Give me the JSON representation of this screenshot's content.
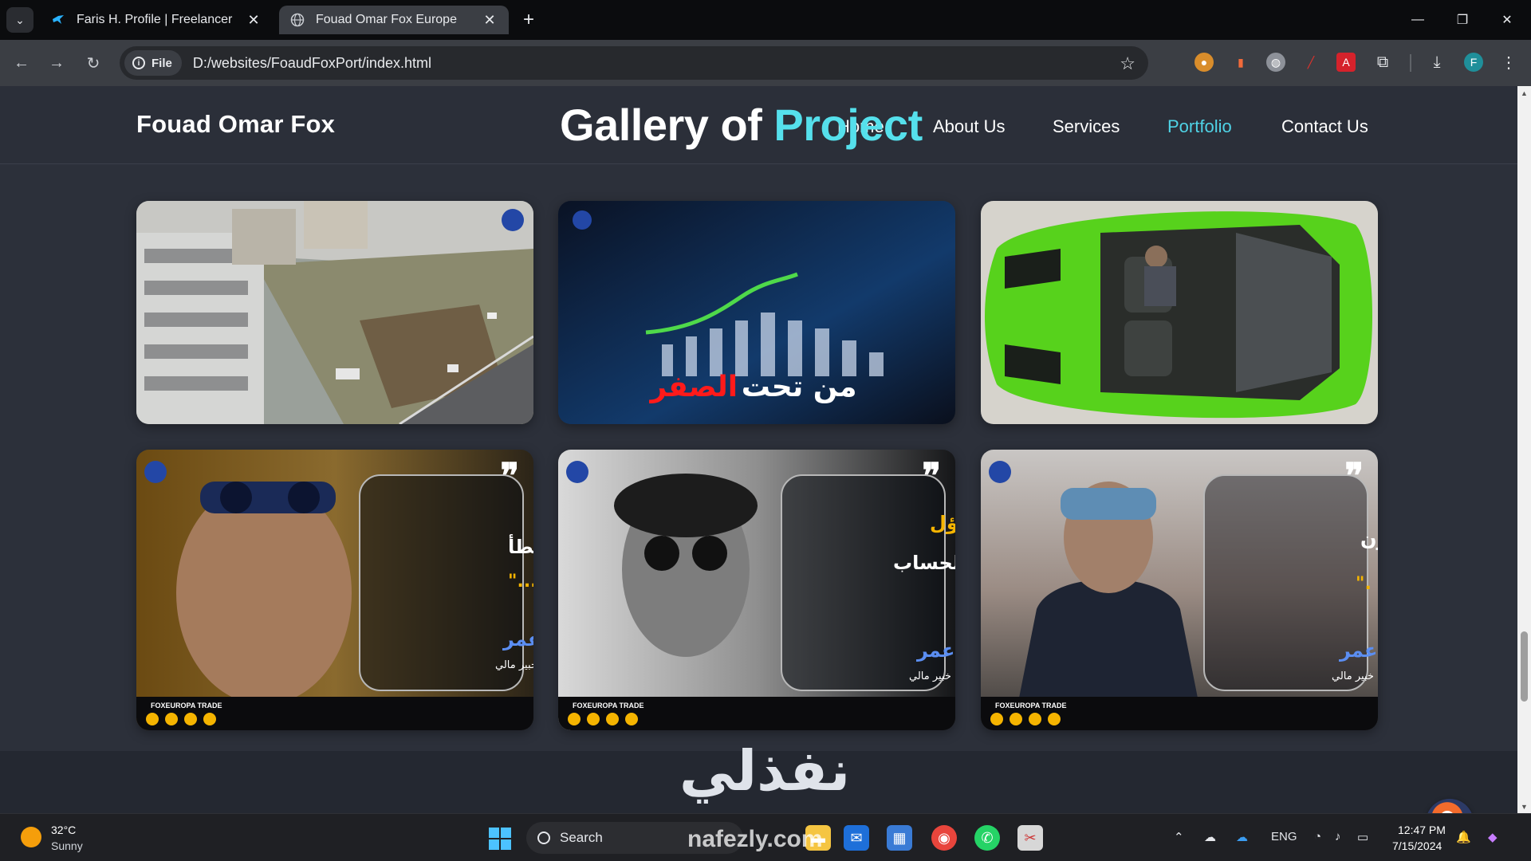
{
  "browser": {
    "tabs": [
      {
        "title": "Faris H. Profile | Freelancer",
        "active": false
      },
      {
        "title": "Fouad Omar Fox Europe",
        "active": true
      }
    ],
    "site_chip": "File",
    "url": "D:/websites/FoaudFoxPort/index.html",
    "profile_initial": "F"
  },
  "site": {
    "logo": "Fouad Omar Fox",
    "nav": [
      {
        "label": "Home"
      },
      {
        "label": "About Us"
      },
      {
        "label": "Services"
      },
      {
        "label": "Portfolio",
        "active": true
      },
      {
        "label": "Contact Us"
      }
    ],
    "gallery_title_part1": "Gallery of ",
    "gallery_title_part2": "Project",
    "cards": [
      {
        "subject": "aerial-construction"
      },
      {
        "subject": "chart-thumbnail",
        "text_white": "من تحت",
        "text_red": "الصفر"
      },
      {
        "subject": "green-sports-car"
      },
      {
        "subject": "quote-card",
        "quote_line1": "\"لا تركب القطار الخطأ",
        "quote_line2": "لمجرد ان الانتظار مزعج...\"",
        "signature": "فؤاد عمر",
        "role": "خبير مالي",
        "brand": "FOXEUROPA TRADE"
      },
      {
        "subject": "quote-card",
        "quote_line1": "لا تشتري من التفاؤل",
        "quote_line2": "بل بالحساب",
        "signature": "فؤاد عمر",
        "role": "خبير مالي",
        "brand": "FOXEUROPA TRADE"
      },
      {
        "subject": "quote-card",
        "quote_line1": "\"بعض الناس قلقون",
        "quote_line2": "وآخرون يستعدون .\"",
        "signature": "فؤاد عمر",
        "role": "خبير مالي",
        "brand": "FOXEUROPA TRADE"
      }
    ],
    "watermark_ar": "نفذلي",
    "watermark_url": "nafezly.com"
  },
  "taskbar": {
    "temperature": "32°C",
    "condition": "Sunny",
    "search_placeholder": "Search",
    "language": "ENG",
    "time": "12:47 PM",
    "date": "7/15/2024"
  },
  "colors": {
    "accent": "#4fd3e6",
    "page_bg": "#2c303a",
    "quote_gold": "#f5b400"
  }
}
